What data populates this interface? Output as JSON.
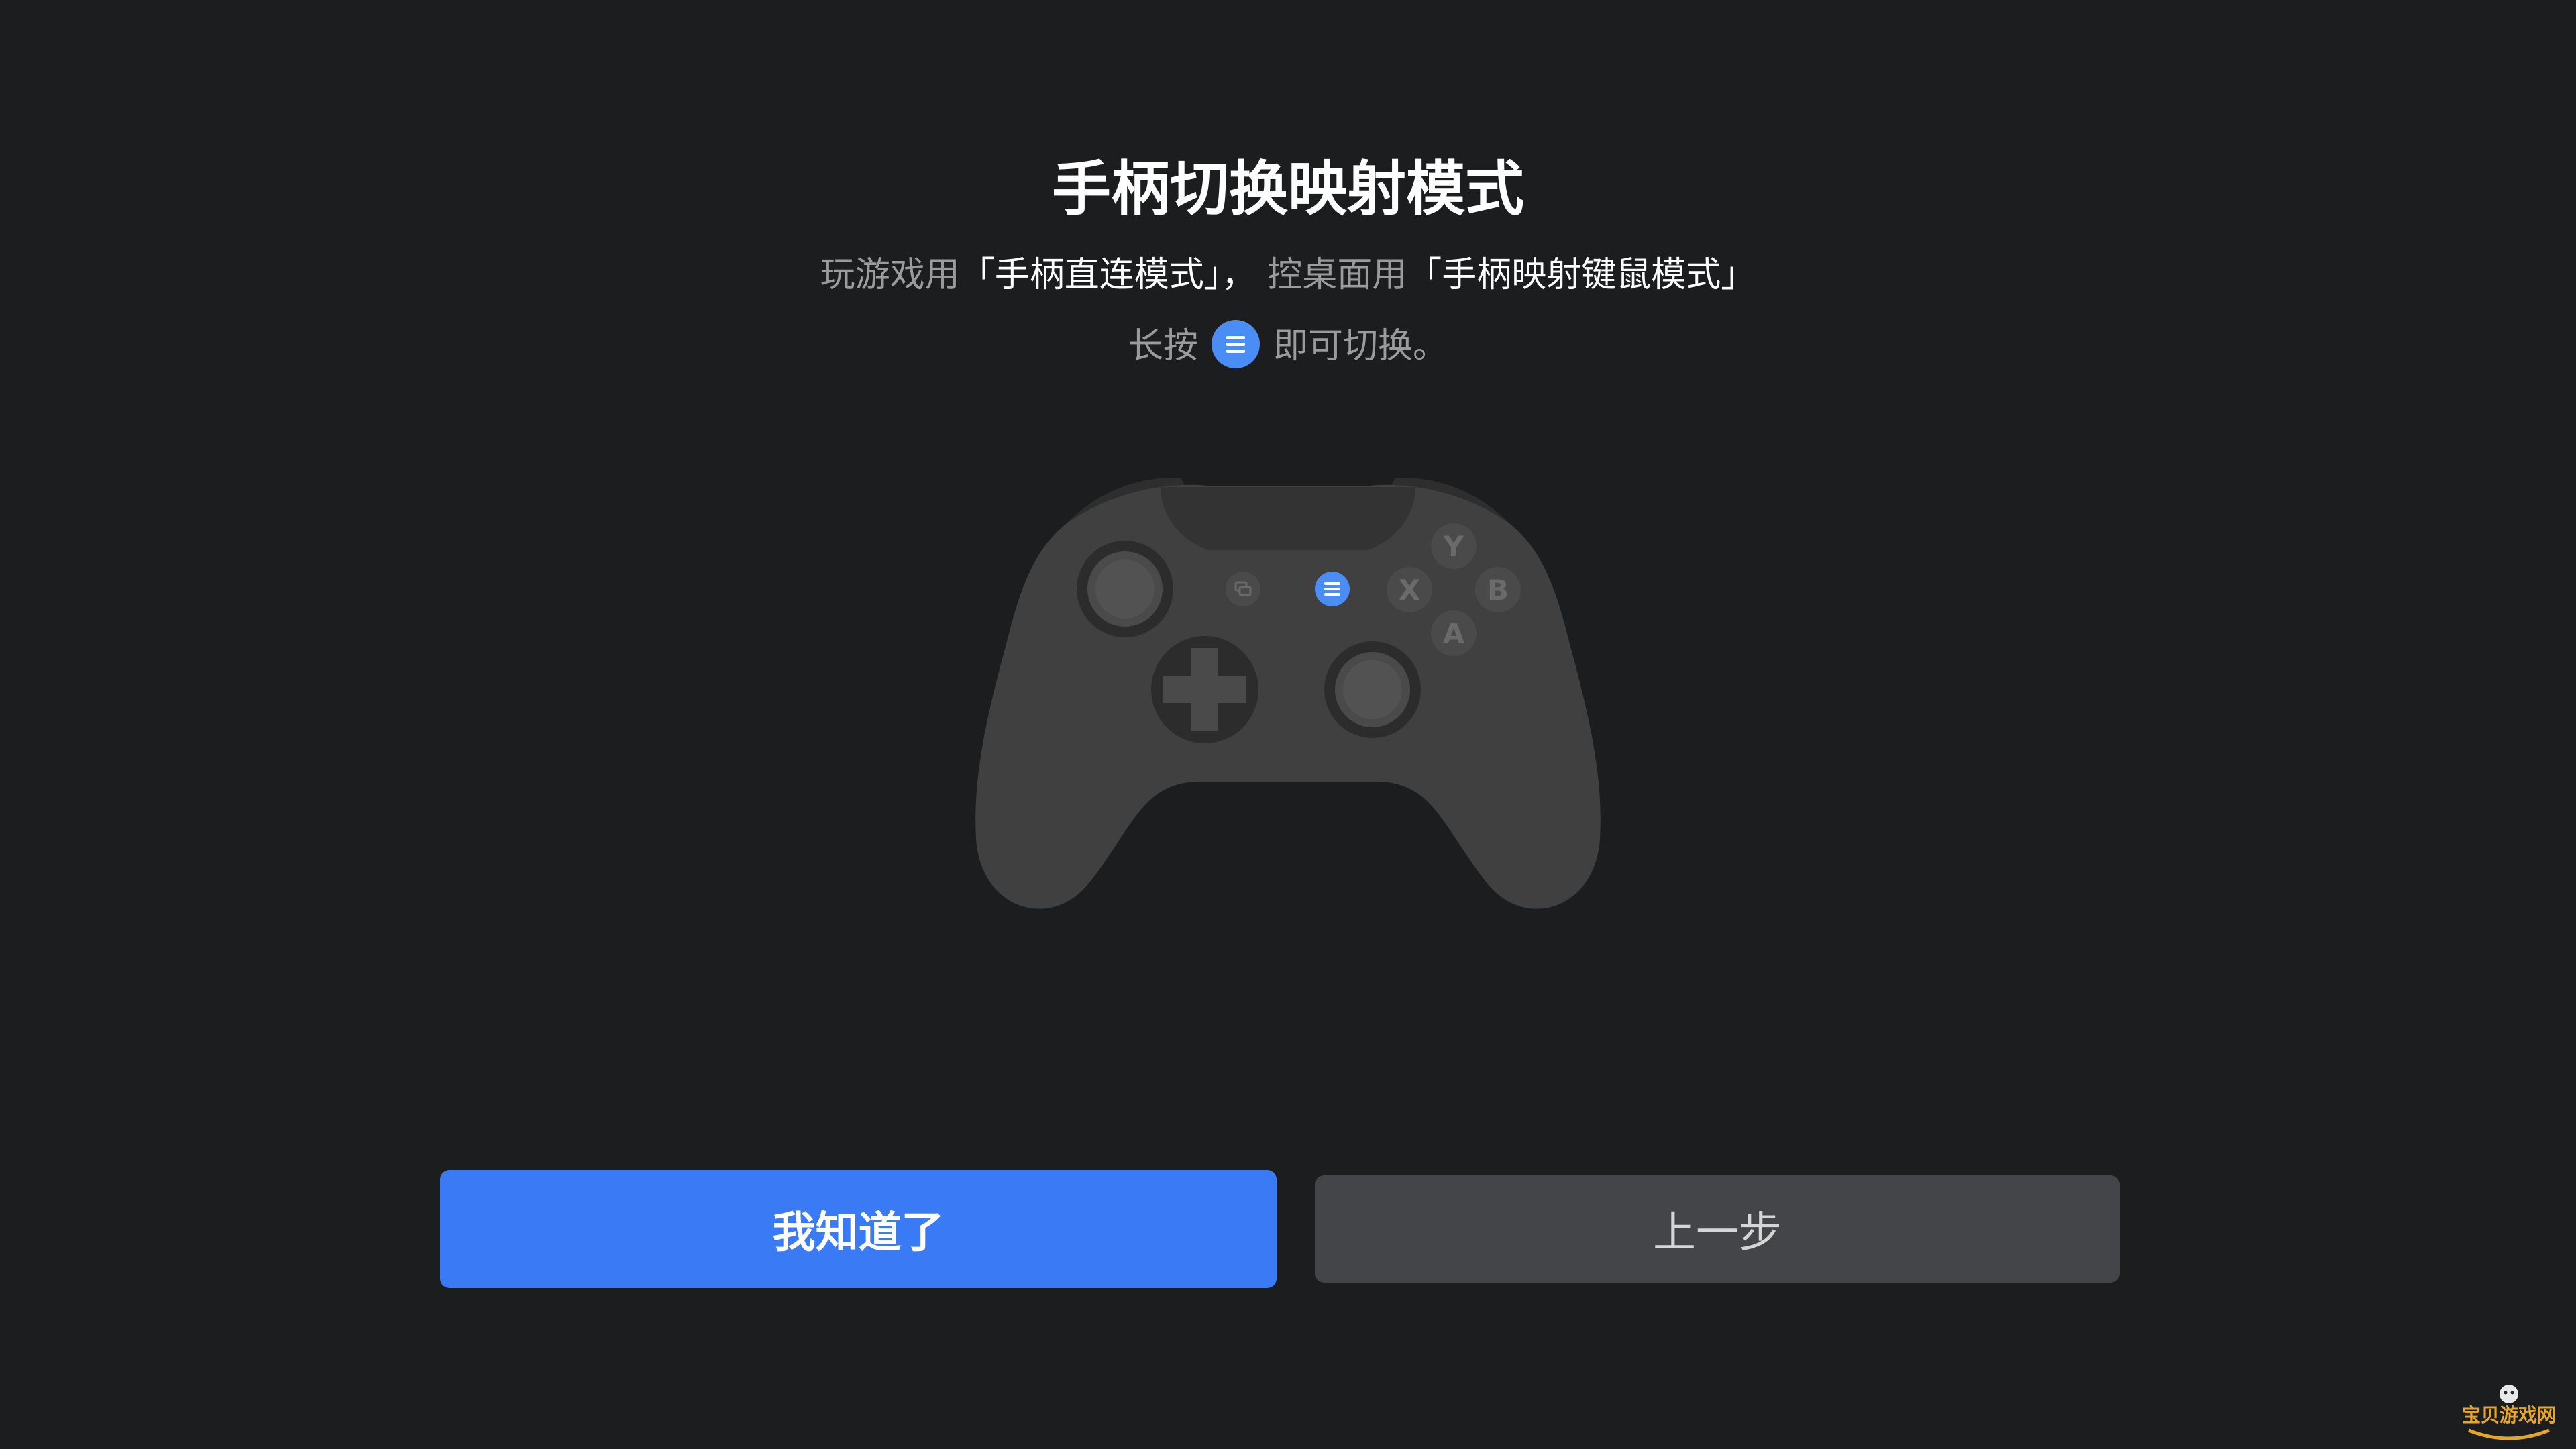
{
  "dialog": {
    "title": "手柄切换映射模式",
    "subtitle": {
      "part1": "玩游戏用",
      "mode1": "「手柄直连模式」，",
      "part2": "控桌面用",
      "mode2": "「手柄映射键鼠模式」"
    },
    "hint": {
      "prefix": "长按",
      "icon": "menu-icon",
      "suffix": "即可切换。"
    }
  },
  "controller": {
    "face_buttons": {
      "top": "Y",
      "left": "X",
      "right": "B",
      "bottom": "A"
    },
    "highlighted_button": "menu-button"
  },
  "actions": {
    "confirm_label": "我知道了",
    "back_label": "上一步"
  },
  "watermark": {
    "text": "宝贝游戏网"
  },
  "colors": {
    "background": "#1c1d1f",
    "accent": "#3a7bf5",
    "menu_highlight": "#4a8df5",
    "secondary_button": "#444549",
    "controller_body": "#404040"
  }
}
